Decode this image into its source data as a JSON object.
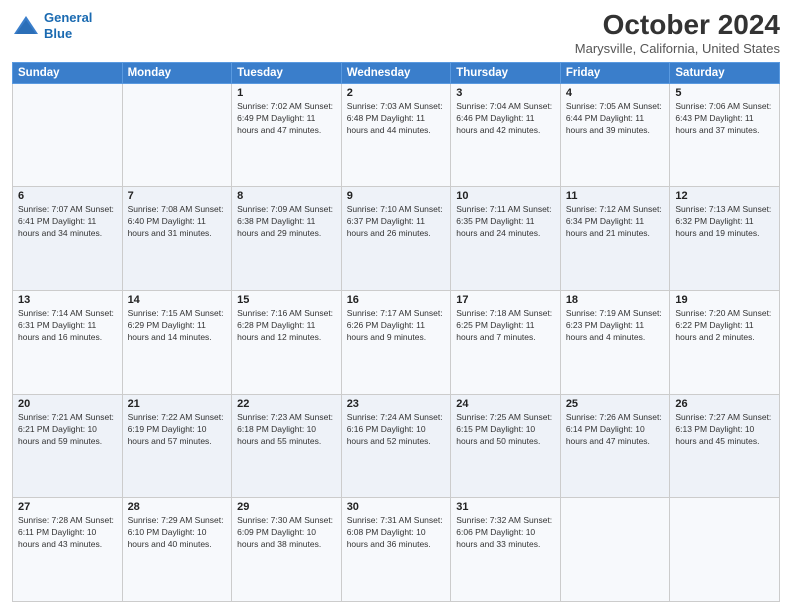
{
  "header": {
    "logo_line1": "General",
    "logo_line2": "Blue",
    "month": "October 2024",
    "location": "Marysville, California, United States"
  },
  "weekdays": [
    "Sunday",
    "Monday",
    "Tuesday",
    "Wednesday",
    "Thursday",
    "Friday",
    "Saturday"
  ],
  "weeks": [
    [
      {
        "day": "",
        "detail": ""
      },
      {
        "day": "",
        "detail": ""
      },
      {
        "day": "1",
        "detail": "Sunrise: 7:02 AM\nSunset: 6:49 PM\nDaylight: 11 hours\nand 47 minutes."
      },
      {
        "day": "2",
        "detail": "Sunrise: 7:03 AM\nSunset: 6:48 PM\nDaylight: 11 hours\nand 44 minutes."
      },
      {
        "day": "3",
        "detail": "Sunrise: 7:04 AM\nSunset: 6:46 PM\nDaylight: 11 hours\nand 42 minutes."
      },
      {
        "day": "4",
        "detail": "Sunrise: 7:05 AM\nSunset: 6:44 PM\nDaylight: 11 hours\nand 39 minutes."
      },
      {
        "day": "5",
        "detail": "Sunrise: 7:06 AM\nSunset: 6:43 PM\nDaylight: 11 hours\nand 37 minutes."
      }
    ],
    [
      {
        "day": "6",
        "detail": "Sunrise: 7:07 AM\nSunset: 6:41 PM\nDaylight: 11 hours\nand 34 minutes."
      },
      {
        "day": "7",
        "detail": "Sunrise: 7:08 AM\nSunset: 6:40 PM\nDaylight: 11 hours\nand 31 minutes."
      },
      {
        "day": "8",
        "detail": "Sunrise: 7:09 AM\nSunset: 6:38 PM\nDaylight: 11 hours\nand 29 minutes."
      },
      {
        "day": "9",
        "detail": "Sunrise: 7:10 AM\nSunset: 6:37 PM\nDaylight: 11 hours\nand 26 minutes."
      },
      {
        "day": "10",
        "detail": "Sunrise: 7:11 AM\nSunset: 6:35 PM\nDaylight: 11 hours\nand 24 minutes."
      },
      {
        "day": "11",
        "detail": "Sunrise: 7:12 AM\nSunset: 6:34 PM\nDaylight: 11 hours\nand 21 minutes."
      },
      {
        "day": "12",
        "detail": "Sunrise: 7:13 AM\nSunset: 6:32 PM\nDaylight: 11 hours\nand 19 minutes."
      }
    ],
    [
      {
        "day": "13",
        "detail": "Sunrise: 7:14 AM\nSunset: 6:31 PM\nDaylight: 11 hours\nand 16 minutes."
      },
      {
        "day": "14",
        "detail": "Sunrise: 7:15 AM\nSunset: 6:29 PM\nDaylight: 11 hours\nand 14 minutes."
      },
      {
        "day": "15",
        "detail": "Sunrise: 7:16 AM\nSunset: 6:28 PM\nDaylight: 11 hours\nand 12 minutes."
      },
      {
        "day": "16",
        "detail": "Sunrise: 7:17 AM\nSunset: 6:26 PM\nDaylight: 11 hours\nand 9 minutes."
      },
      {
        "day": "17",
        "detail": "Sunrise: 7:18 AM\nSunset: 6:25 PM\nDaylight: 11 hours\nand 7 minutes."
      },
      {
        "day": "18",
        "detail": "Sunrise: 7:19 AM\nSunset: 6:23 PM\nDaylight: 11 hours\nand 4 minutes."
      },
      {
        "day": "19",
        "detail": "Sunrise: 7:20 AM\nSunset: 6:22 PM\nDaylight: 11 hours\nand 2 minutes."
      }
    ],
    [
      {
        "day": "20",
        "detail": "Sunrise: 7:21 AM\nSunset: 6:21 PM\nDaylight: 10 hours\nand 59 minutes."
      },
      {
        "day": "21",
        "detail": "Sunrise: 7:22 AM\nSunset: 6:19 PM\nDaylight: 10 hours\nand 57 minutes."
      },
      {
        "day": "22",
        "detail": "Sunrise: 7:23 AM\nSunset: 6:18 PM\nDaylight: 10 hours\nand 55 minutes."
      },
      {
        "day": "23",
        "detail": "Sunrise: 7:24 AM\nSunset: 6:16 PM\nDaylight: 10 hours\nand 52 minutes."
      },
      {
        "day": "24",
        "detail": "Sunrise: 7:25 AM\nSunset: 6:15 PM\nDaylight: 10 hours\nand 50 minutes."
      },
      {
        "day": "25",
        "detail": "Sunrise: 7:26 AM\nSunset: 6:14 PM\nDaylight: 10 hours\nand 47 minutes."
      },
      {
        "day": "26",
        "detail": "Sunrise: 7:27 AM\nSunset: 6:13 PM\nDaylight: 10 hours\nand 45 minutes."
      }
    ],
    [
      {
        "day": "27",
        "detail": "Sunrise: 7:28 AM\nSunset: 6:11 PM\nDaylight: 10 hours\nand 43 minutes."
      },
      {
        "day": "28",
        "detail": "Sunrise: 7:29 AM\nSunset: 6:10 PM\nDaylight: 10 hours\nand 40 minutes."
      },
      {
        "day": "29",
        "detail": "Sunrise: 7:30 AM\nSunset: 6:09 PM\nDaylight: 10 hours\nand 38 minutes."
      },
      {
        "day": "30",
        "detail": "Sunrise: 7:31 AM\nSunset: 6:08 PM\nDaylight: 10 hours\nand 36 minutes."
      },
      {
        "day": "31",
        "detail": "Sunrise: 7:32 AM\nSunset: 6:06 PM\nDaylight: 10 hours\nand 33 minutes."
      },
      {
        "day": "",
        "detail": ""
      },
      {
        "day": "",
        "detail": ""
      }
    ]
  ]
}
